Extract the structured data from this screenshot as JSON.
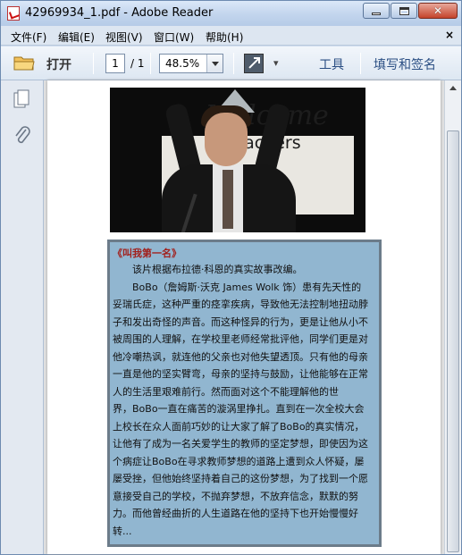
{
  "window": {
    "title": "42969934_1.pdf - Adobe Reader",
    "close_glyph": "✕"
  },
  "menu": {
    "items": [
      "文件(F)",
      "编辑(E)",
      "视图(V)",
      "窗口(W)",
      "帮助(H)"
    ],
    "close_glyph": "×"
  },
  "toolbar": {
    "open_label": "打开",
    "page_current": "1",
    "page_total": "/ 1",
    "zoom": "48.5%",
    "tools_label": "工具",
    "sign_label": "填写和签名"
  },
  "document": {
    "photo_text_1": "Welcome",
    "photo_text_2": "Teachers",
    "heading": "《叫我第一名》",
    "lines": [
      "　　该片根据布拉德·科恩的真实故事改编。",
      "　　BoBo（詹姆斯·沃克 James Wolk 饰）患有先天性的",
      "妥瑞氏症，这种严重的痉挛疾病，导致他无法控制地扭动脖",
      "子和发出奇怪的声音。而这种怪异的行为，更是让他从小不",
      "被周围的人理解，在学校里老师经常批评他，同学们更是对",
      "他冷嘲热讽，就连他的父亲也对他失望透顶。只有他的母亲",
      "一直是他的坚实臂弯，母亲的坚持与鼓励，让他能够在正常",
      "人的生活里艰难前行。然而面对这个不能理解他的世",
      "界，BoBo一直在痛苦的漩涡里挣扎。直到在一次全校大会",
      "上校长在众人面前巧妙的让大家了解了BoBo的真实情况，",
      "让他有了成为一名关爱学生的教师的坚定梦想，即使因为这",
      "个病症让BoBo在寻求教师梦想的道路上遭到众人怀疑，屡",
      "屡受挫，但他始终坚持着自己的这份梦想，为了找到一个愿",
      "意接受自己的学校，不抛弃梦想，不放弃信念，默默的努",
      "力。而他曾经曲折的人生道路在他的坚持下也开始慢慢好",
      "转..."
    ]
  }
}
